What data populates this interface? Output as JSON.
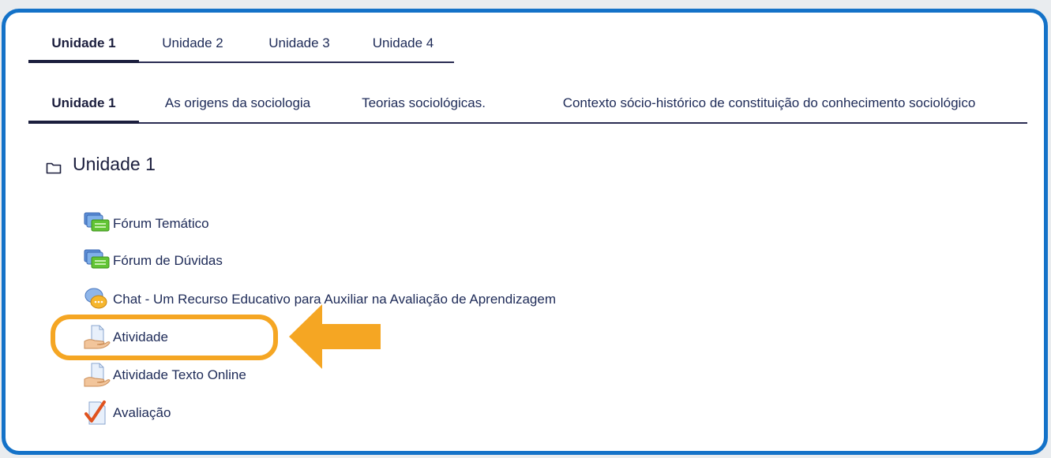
{
  "unit_tabs": [
    {
      "label": "Unidade 1",
      "active": true
    },
    {
      "label": "Unidade 2",
      "active": false
    },
    {
      "label": "Unidade 3",
      "active": false
    },
    {
      "label": "Unidade 4",
      "active": false
    }
  ],
  "topic_tabs": [
    {
      "label": "Unidade 1",
      "active": true
    },
    {
      "label": "As origens da sociologia",
      "active": false
    },
    {
      "label": "Teorias sociológicas.",
      "active": false
    },
    {
      "label": "Contexto sócio-histórico de constituição do conhecimento sociológico",
      "active": false
    }
  ],
  "section": {
    "title": "Unidade 1",
    "icon": "folder-icon"
  },
  "activities": [
    {
      "label": "Fórum Temático",
      "icon": "forum-icon"
    },
    {
      "label": "Fórum de Dúvidas",
      "icon": "forum-icon"
    },
    {
      "label": "Chat - Um Recurso Educativo para Auxiliar na Avaliação de Aprendizagem",
      "icon": "chat-icon"
    },
    {
      "label": "Atividade",
      "icon": "assignment-icon"
    },
    {
      "label": "Atividade Texto Online",
      "icon": "assignment-icon"
    },
    {
      "label": "Avaliação",
      "icon": "quiz-icon"
    }
  ],
  "colors": {
    "frame": "#1472c8",
    "highlight": "#f5a623",
    "text": "#1d2a57",
    "underline": "#2a2c52"
  }
}
